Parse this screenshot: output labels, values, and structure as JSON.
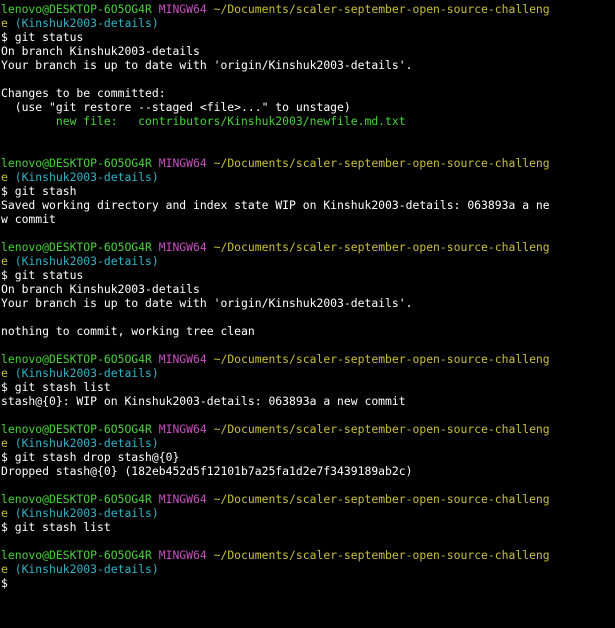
{
  "colors": {
    "background": "#000000",
    "user_host": "#49d23a",
    "mingw": "#c84fc0",
    "path": "#c9bf3b",
    "branch": "#2fb5c8",
    "staged_file": "#49d23a",
    "text": "#ffffff"
  },
  "prompt": {
    "user_host": "lenovo@DESKTOP-6O5OG4R",
    "shell": "MINGW64",
    "path_part1": "~/Documents/scaler-september-open-source-challeng",
    "path_part2": "e",
    "branch": "(Kinshuk2003-details)",
    "symbol": "$"
  },
  "block1": {
    "command": "git status",
    "out1": "On branch Kinshuk2003-details",
    "out2": "Your branch is up to date with 'origin/Kinshuk2003-details'.",
    "out3": "Changes to be committed:",
    "out4": "  (use \"git restore --staged <file>...\" to unstage)",
    "staged_label": "        new file:   ",
    "staged_path": "contributors/Kinshuk2003/newfile.md.txt"
  },
  "block2": {
    "command": "git stash",
    "out1": "Saved working directory and index state WIP on Kinshuk2003-details: 063893a a ne",
    "out2": "w commit"
  },
  "block3": {
    "command": "git status",
    "out1": "On branch Kinshuk2003-details",
    "out2": "Your branch is up to date with 'origin/Kinshuk2003-details'.",
    "out3": "nothing to commit, working tree clean"
  },
  "block4": {
    "command": "git stash list",
    "out1": "stash@{0}: WIP on Kinshuk2003-details: 063893a a new commit"
  },
  "block5": {
    "command": "git stash drop stash@{0}",
    "out1": "Dropped stash@{0} (182eb452d5f12101b7a25fa1d2e7f3439189ab2c)"
  },
  "block6": {
    "command": "git stash list"
  }
}
